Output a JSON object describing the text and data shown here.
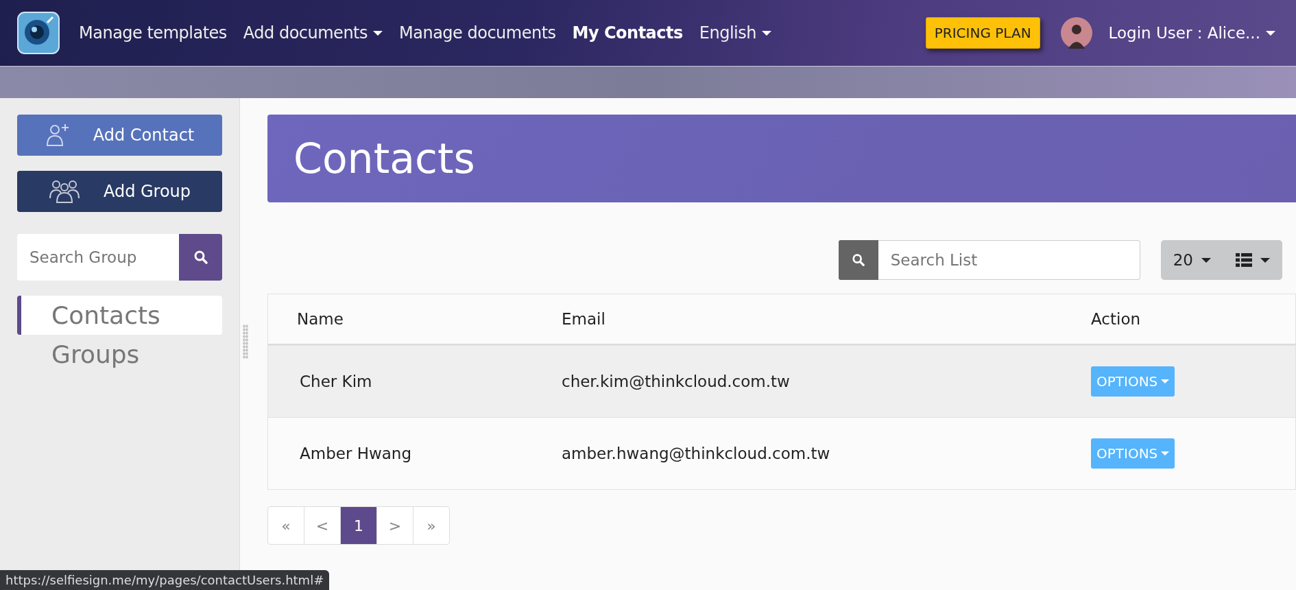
{
  "nav": {
    "items": [
      {
        "label": "Manage templates",
        "dropdown": false,
        "selected": false
      },
      {
        "label": "Add documents",
        "dropdown": true,
        "selected": false
      },
      {
        "label": "Manage documents",
        "dropdown": false,
        "selected": false
      },
      {
        "label": "My Contacts",
        "dropdown": false,
        "selected": true
      },
      {
        "label": "English",
        "dropdown": true,
        "selected": false
      }
    ],
    "pricing_button": "PRICING PLAN",
    "user": "Login User : Alice..."
  },
  "sidebar": {
    "buttons": [
      {
        "label": "Add Contact",
        "kind": "contact"
      },
      {
        "label": "Add Group",
        "kind": "group"
      }
    ],
    "search": {
      "placeholder": "Search Group"
    },
    "items": [
      {
        "label": "Contacts",
        "selected": true
      },
      {
        "label": "Groups",
        "selected": false
      }
    ]
  },
  "banner": {
    "title": "Contacts"
  },
  "toolbar": {
    "search": {
      "placeholder": "Search List"
    },
    "page_size": "20"
  },
  "table": {
    "columns": [
      "Name",
      "Email",
      "Action"
    ],
    "rows": [
      {
        "name": "Cher Kim",
        "email": "cher.kim@thinkcloud.com.tw",
        "action": "OPTIONS",
        "highlighted": true
      },
      {
        "name": "Amber Hwang",
        "email": "amber.hwang@thinkcloud.com.tw",
        "action": "OPTIONS",
        "highlighted": false
      }
    ]
  },
  "pagination": [
    {
      "label": "«",
      "selected": false
    },
    {
      "label": "<",
      "selected": false
    },
    {
      "label": "1",
      "selected": true
    },
    {
      "label": ">",
      "selected": false
    },
    {
      "label": "»",
      "selected": false
    }
  ],
  "status_bar": {
    "url": "https://selfiesign.me/my/pages/contactUsers.html#"
  }
}
